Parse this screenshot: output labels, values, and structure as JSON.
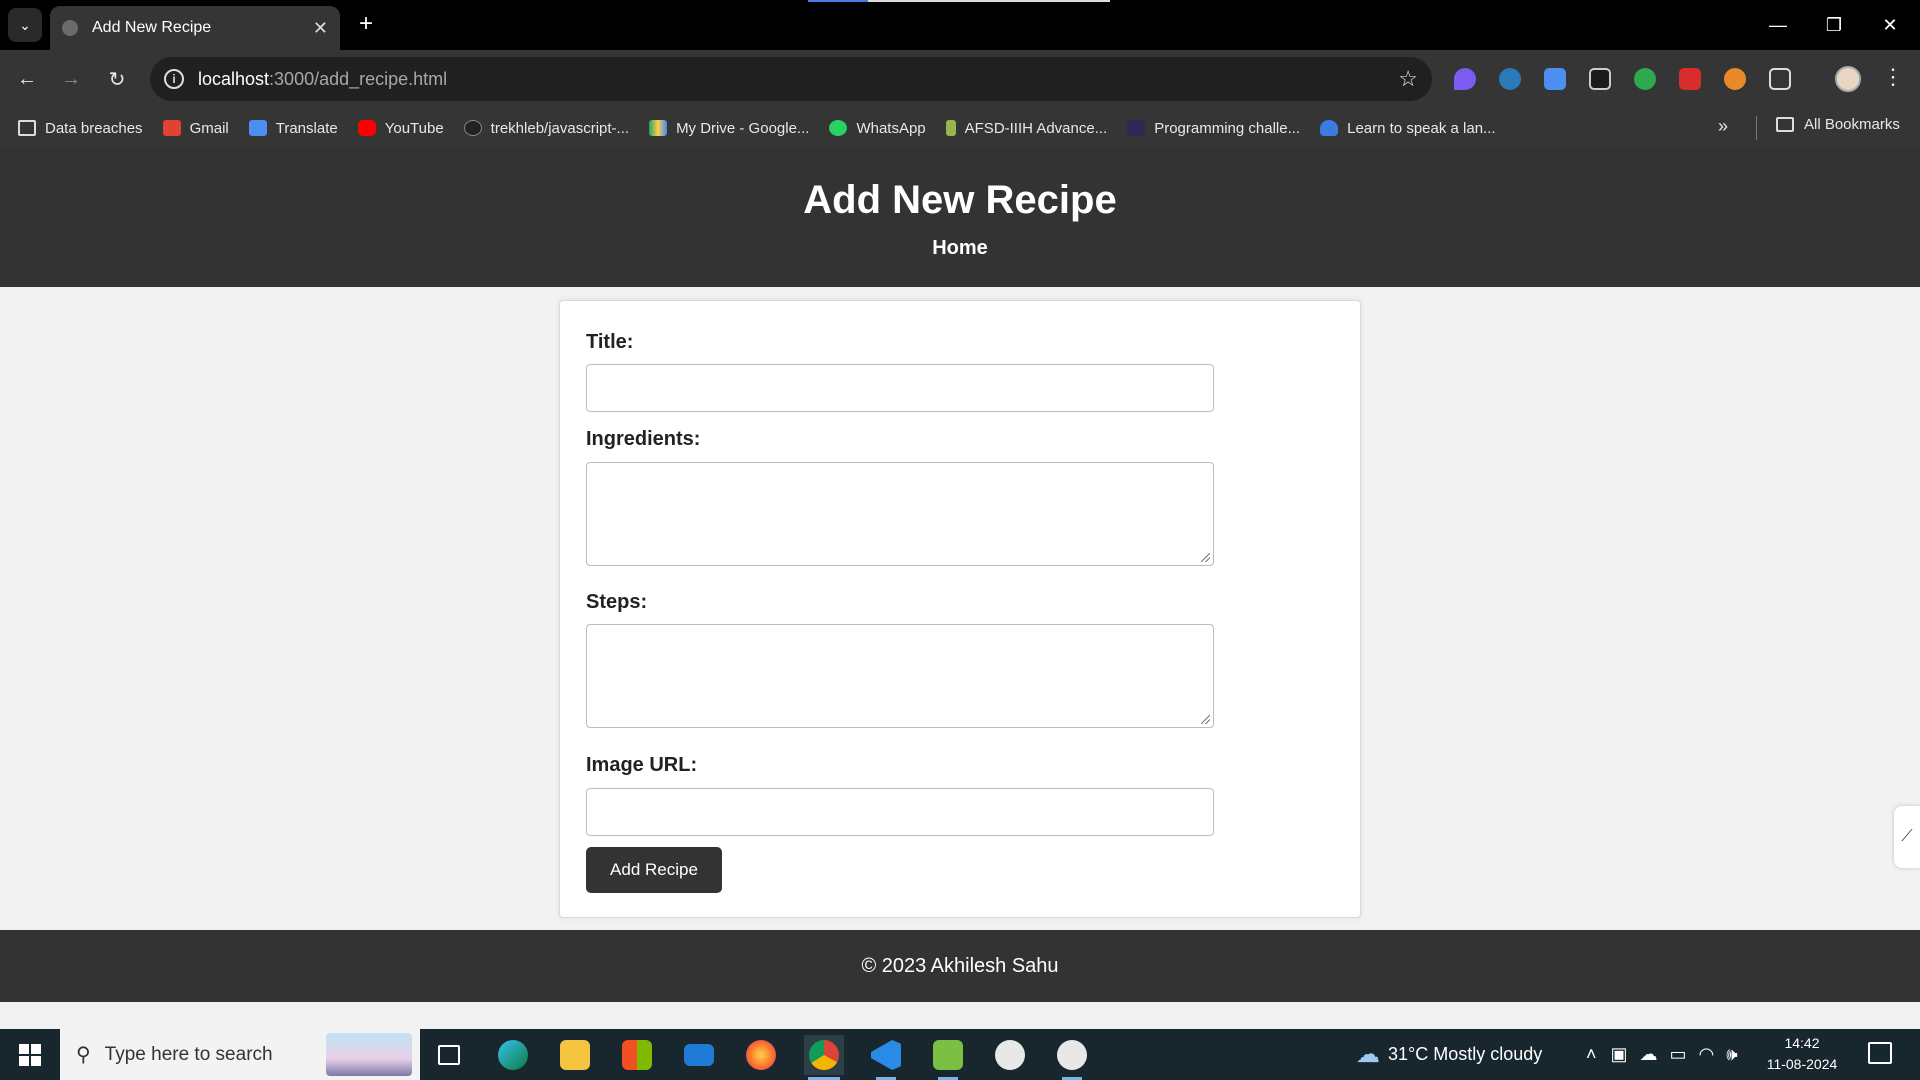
{
  "browser": {
    "tab_title": "Add New Recipe",
    "tab_close": "✕",
    "new_tab": "+",
    "url_host": "localhost",
    "url_path": ":3000/add_recipe.html",
    "window_controls": {
      "minimize": "—",
      "restore": "❐",
      "close": "✕"
    },
    "bookmarks": [
      {
        "label": "Data breaches",
        "icon": "folder-icon"
      },
      {
        "label": "Gmail",
        "icon": "gmail-icon"
      },
      {
        "label": "Translate",
        "icon": "translate-icon"
      },
      {
        "label": "YouTube",
        "icon": "youtube-icon"
      },
      {
        "label": "trekhleb/javascript-...",
        "icon": "github-icon"
      },
      {
        "label": "My Drive - Google...",
        "icon": "drive-icon"
      },
      {
        "label": "WhatsApp",
        "icon": "whatsapp-icon"
      },
      {
        "label": "AFSD-IIIH Advance...",
        "icon": "site-icon"
      },
      {
        "label": "Programming challe...",
        "icon": "site-icon"
      },
      {
        "label": "Learn to speak a lan...",
        "icon": "site-icon"
      }
    ],
    "bookmarks_more": "»",
    "all_bookmarks": "All Bookmarks"
  },
  "page": {
    "title": "Add New Recipe",
    "nav_home": "Home",
    "form": {
      "title_label": "Title:",
      "ingredients_label": "Ingredients:",
      "steps_label": "Steps:",
      "image_url_label": "Image URL:",
      "title_value": "",
      "ingredients_value": "",
      "steps_value": "",
      "image_url_value": "",
      "submit_label": "Add Recipe"
    },
    "footer": "© 2023 Akhilesh Sahu"
  },
  "taskbar": {
    "search_placeholder": "Type here to search",
    "weather": "31°C  Mostly cloudy",
    "time": "14:42",
    "date": "11-08-2024"
  },
  "colors": {
    "header_bg": "#333333",
    "page_bg": "#f2f2f2",
    "button_bg": "#333333"
  }
}
